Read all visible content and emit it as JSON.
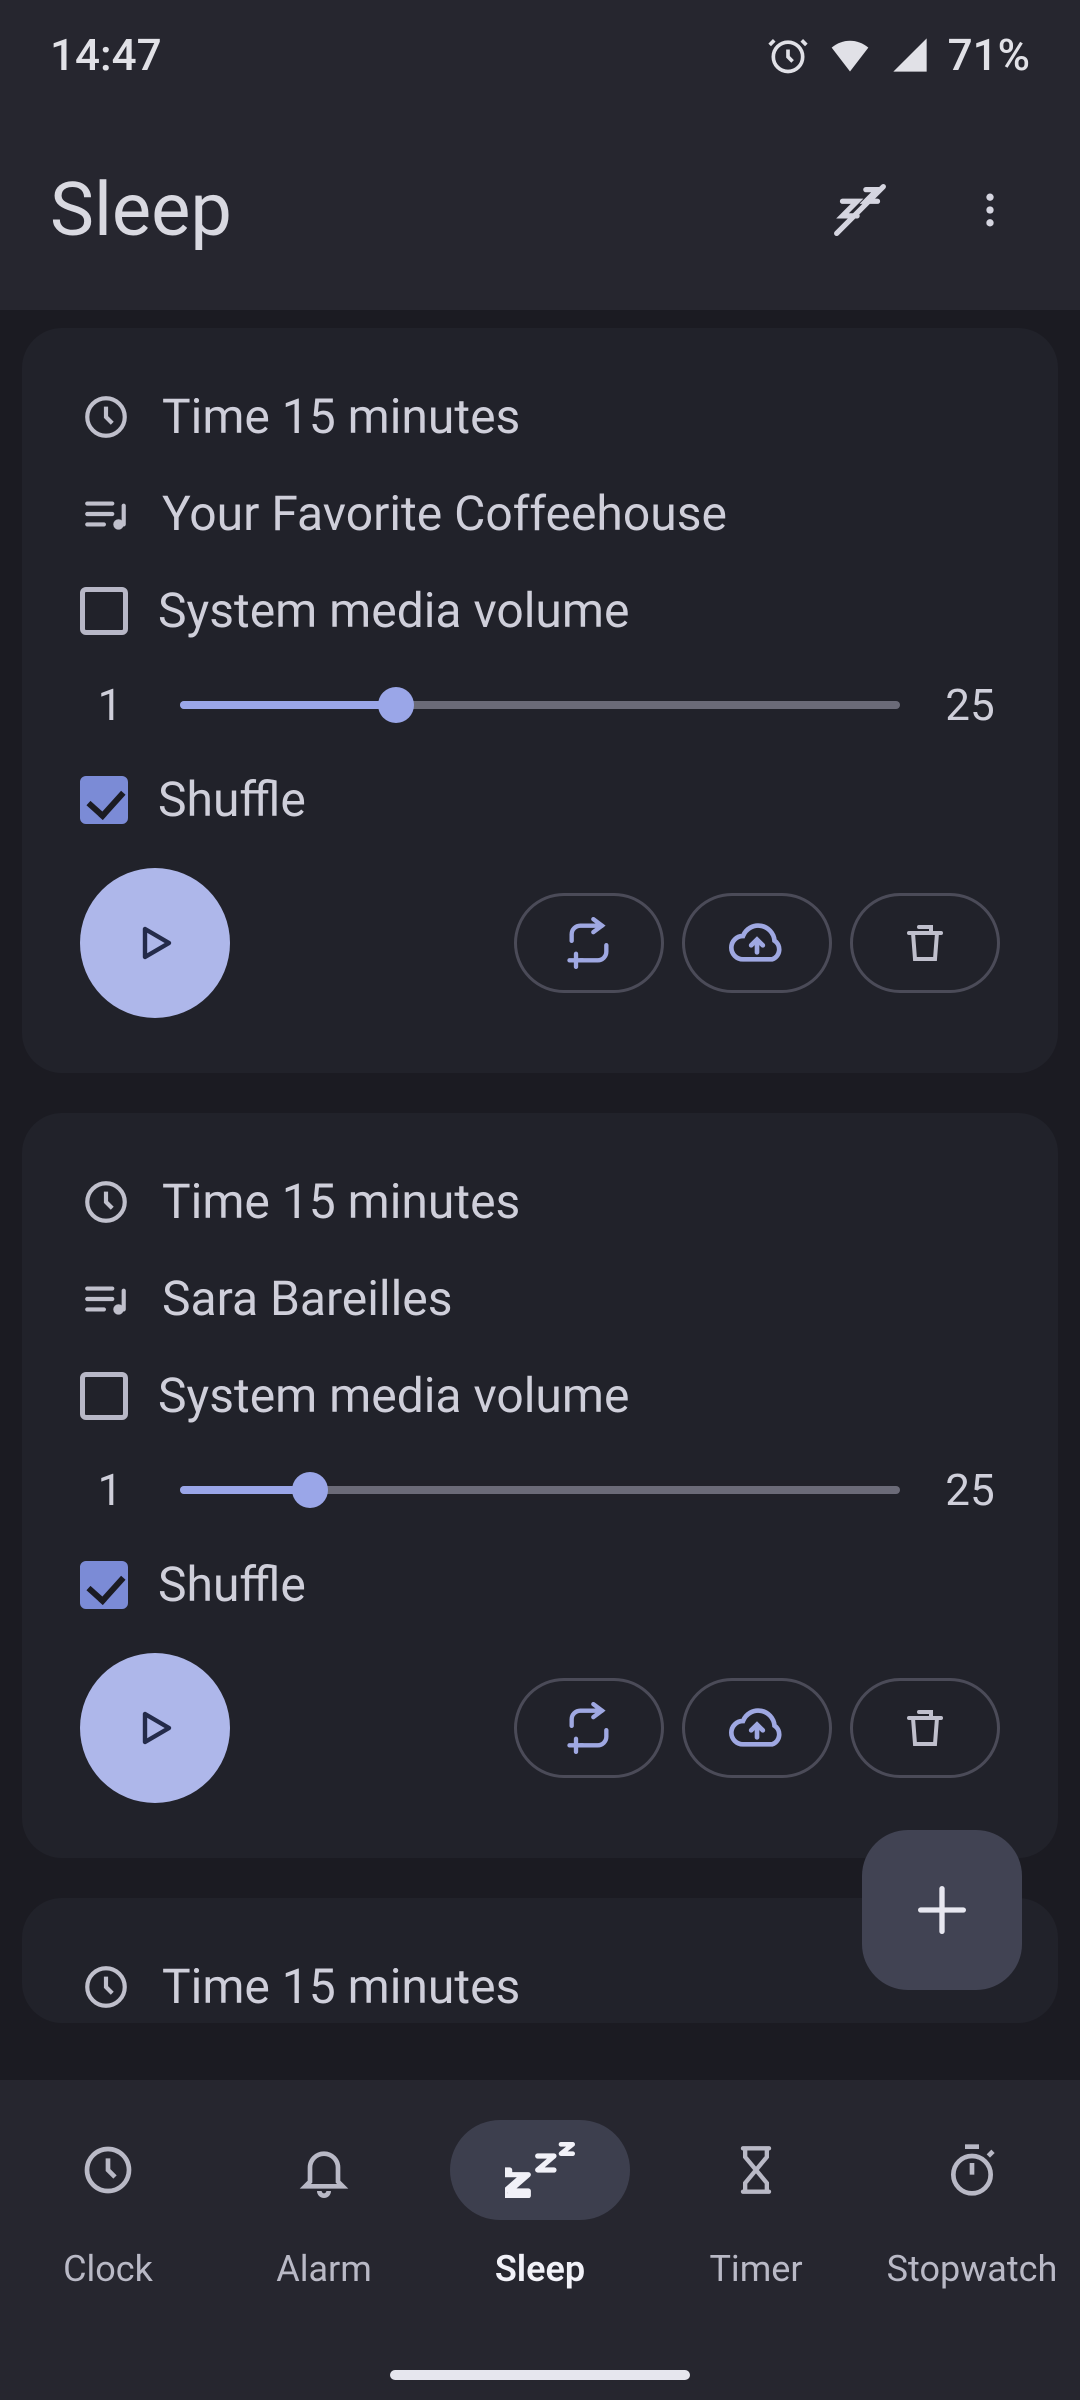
{
  "status": {
    "time": "14:47",
    "battery": "71%"
  },
  "appbar": {
    "title": "Sleep"
  },
  "labels": {
    "system_volume": "System media volume",
    "shuffle": "Shuffle"
  },
  "slider": {
    "min": "1",
    "max": "25"
  },
  "cards": [
    {
      "time": "Time 15 minutes",
      "playlist": "Your Favorite Coffeehouse",
      "system_volume_checked": false,
      "shuffle_checked": true,
      "slider_fill_pct": 30
    },
    {
      "time": "Time 15 minutes",
      "playlist": "Sara Bareilles",
      "system_volume_checked": false,
      "shuffle_checked": true,
      "slider_fill_pct": 18
    },
    {
      "time": "Time 15 minutes"
    }
  ],
  "nav": {
    "clock": "Clock",
    "alarm": "Alarm",
    "sleep": "Sleep",
    "timer": "Timer",
    "stopwatch": "Stopwatch"
  }
}
